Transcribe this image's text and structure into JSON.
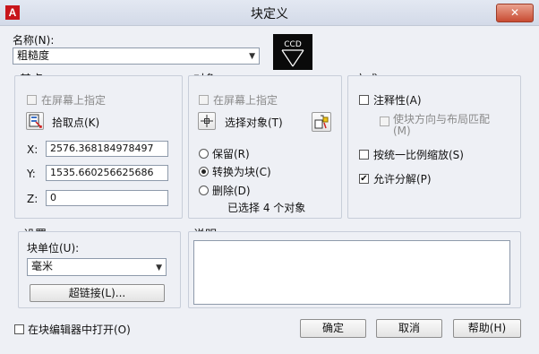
{
  "window": {
    "title": "块定义",
    "close_label": "✕"
  },
  "name": {
    "label": "名称(N):",
    "value": "粗糙度"
  },
  "base_point": {
    "group_label": "基点",
    "specify_on_screen": "在屏幕上指定",
    "pick_point": "拾取点(K)",
    "x_label": "X:",
    "x_value": "2576.368184978497",
    "y_label": "Y:",
    "y_value": "1535.660256625686",
    "z_label": "Z:",
    "z_value": "0"
  },
  "objects": {
    "group_label": "对象",
    "specify_on_screen": "在屏幕上指定",
    "select_objects": "选择对象(T)",
    "retain": "保留(R)",
    "convert_to_block": "转换为块(C)",
    "delete": "删除(D)",
    "selected_count": "已选择 4 个对象"
  },
  "behavior": {
    "group_label": "方式",
    "annotative": "注释性(A)",
    "match_orientation": "使块方向与布局匹配(M)",
    "scale_uniformly": "按统一比例缩放(S)",
    "allow_exploding": "允许分解(P)"
  },
  "settings": {
    "group_label": "设置",
    "block_unit_label": "块单位(U):",
    "block_unit_value": "毫米",
    "hyperlink": "超链接(L)..."
  },
  "description": {
    "group_label": "说明",
    "value": ""
  },
  "footer": {
    "open_in_editor": "在块编辑器中打开(O)",
    "ok": "确定",
    "cancel": "取消",
    "help": "帮助(H)"
  },
  "preview_symbol": {
    "text": "CCD"
  },
  "states": {
    "open_in_editor_checked": false,
    "annotative_checked": false,
    "scale_uniformly_checked": false,
    "allow_exploding_checked": true,
    "object_mode": "convert_to_block"
  }
}
